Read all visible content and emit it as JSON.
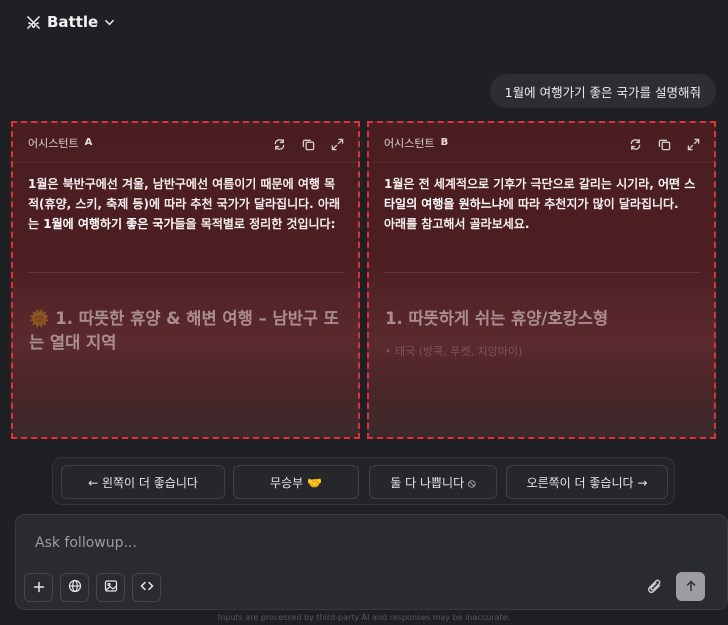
{
  "header": {
    "brand": "Battle"
  },
  "chat": {
    "user_message": "1월에 여행가기 좋은 국가를 설명해줘"
  },
  "panels": {
    "a": {
      "title": "어시스턴트",
      "tag": "A",
      "para_1": "1월은 북반구에선 겨울, 남반구에선 여름이기 때문에 여행 목적(휴양, 스키, 축제 등)에 따라 추천 국가가 달라집니다. 아래는 ",
      "para_bold": "1월에 여행하기 좋은 국가",
      "para_2": "들을 목적별로 정리한 것입니다:",
      "emoji": "🌞",
      "section_title": "1. 따뜻한 휴양 & 해변 여행 – 남반구 또는 열대 지역"
    },
    "b": {
      "title": "어시스턴트",
      "tag": "B",
      "para_1": "1월은 전 세계적으로 기후가 극단으로 갈리는 시기라, ",
      "para_bold": "어떤 스타일의 여행을 원하느냐",
      "para_2": "에 따라 추천지가 많이 달라집니다.",
      "para_3": "아래를 참고해서 골라보세요.",
      "section_title": "1. 따뜻하게 쉬는 휴양/호캉스형",
      "faded_line": "• 태국 (방콕, 푸켓, 치앙마이)"
    }
  },
  "vote": {
    "left_better": "← 왼쪽이 더 좋습니다",
    "tie": "무승부 🤝",
    "both_bad": "둘 다 나쁩니다 ⦸",
    "right_better": "오른쪽이 더 좋습니다 →"
  },
  "composer": {
    "placeholder": "Ask followup..."
  },
  "footer": {
    "disclaimer": "Inputs are processed by third-party AI and responses may be inaccurate."
  }
}
